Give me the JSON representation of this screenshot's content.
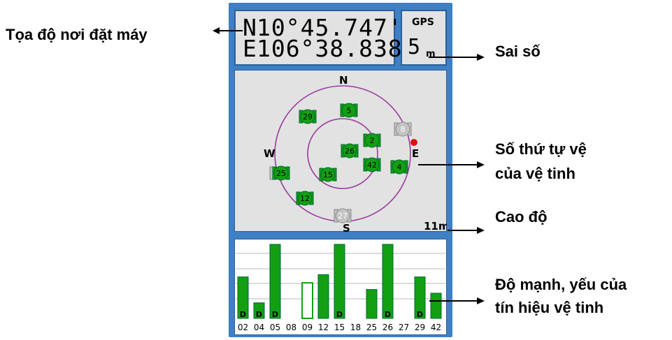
{
  "annotations": {
    "coords_label": "Tọa độ nơi đặt máy",
    "accuracy_label": "Sai số",
    "sat_number_line1": "Số thứ tự vệ",
    "sat_number_line2": "của vệ tinh",
    "altitude_label": "Cao độ",
    "signal_line1": "Độ mạnh, yếu của",
    "signal_line2": "tín hiệu vệ tinh"
  },
  "gps": {
    "lat_hemisphere": "N",
    "lat_value": " 10°45.747'",
    "lon_hemisphere": "E",
    "lon_value": "106°38.838'",
    "status_label": "GPS",
    "accuracy_value": "5",
    "accuracy_unit": "m"
  },
  "skyview": {
    "north": "N",
    "south": "S",
    "east": "E",
    "west": "W",
    "altitude": "11m",
    "satellites": [
      {
        "id": "29",
        "state": "locked"
      },
      {
        "id": "5",
        "state": "locked"
      },
      {
        "id": "8",
        "state": "searching"
      },
      {
        "id": "2",
        "state": "locked"
      },
      {
        "id": "26",
        "state": "locked"
      },
      {
        "id": "42",
        "state": "locked"
      },
      {
        "id": "4",
        "state": "locked"
      },
      {
        "id": "25",
        "state": "locked"
      },
      {
        "id": "15",
        "state": "locked"
      },
      {
        "id": "12",
        "state": "locked"
      },
      {
        "id": "27",
        "state": "searching"
      }
    ]
  },
  "signal_bars": [
    {
      "id": "02",
      "level": 0.56,
      "diff": true,
      "state": "locked"
    },
    {
      "id": "04",
      "level": 0.21,
      "diff": true,
      "state": "locked"
    },
    {
      "id": "05",
      "level": 1.0,
      "diff": true,
      "state": "locked"
    },
    {
      "id": "08",
      "level": 0,
      "diff": false,
      "state": "none"
    },
    {
      "id": "09",
      "level": 0.48,
      "diff": false,
      "state": "acquiring"
    },
    {
      "id": "12",
      "level": 0.59,
      "diff": false,
      "state": "locked"
    },
    {
      "id": "15",
      "level": 1.0,
      "diff": true,
      "state": "locked"
    },
    {
      "id": "18",
      "level": 0,
      "diff": false,
      "state": "none"
    },
    {
      "id": "25",
      "level": 0.39,
      "diff": false,
      "state": "locked"
    },
    {
      "id": "26",
      "level": 1.0,
      "diff": true,
      "state": "locked"
    },
    {
      "id": "27",
      "level": 0,
      "diff": false,
      "state": "none"
    },
    {
      "id": "29",
      "level": 0.56,
      "diff": true,
      "state": "locked"
    },
    {
      "id": "42",
      "level": 0.34,
      "diff": false,
      "state": "locked"
    }
  ],
  "diff_marker": "D",
  "colors": {
    "frame": "#3f7fc4",
    "locked": "#12a012",
    "searching": "#c4c4c4",
    "orbit": "#9a3aa0",
    "ephemeris_dot": "#e01010"
  }
}
